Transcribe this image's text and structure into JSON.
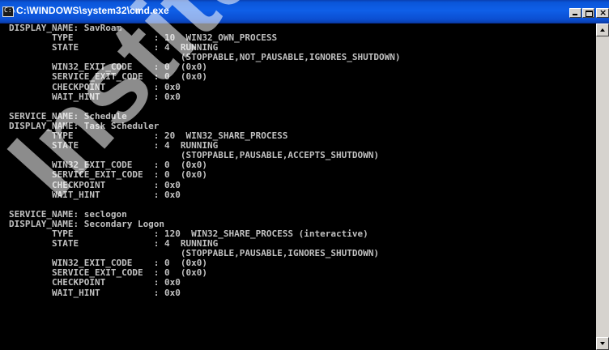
{
  "window": {
    "title": "C:\\WINDOWS\\system32\\cmd.exe",
    "icon_text": "C:\\",
    "controls": {
      "minimize": "minimize",
      "maximize": "maximize",
      "close": "×"
    }
  },
  "console": {
    "lines": [
      "DISPLAY_NAME: SavRoam",
      "        TYPE               : 10  WIN32_OWN_PROCESS",
      "        STATE              : 4  RUNNING",
      "                                (STOPPABLE,NOT_PAUSABLE,IGNORES_SHUTDOWN)",
      "        WIN32_EXIT_CODE    : 0  (0x0)",
      "        SERVICE_EXIT_CODE  : 0  (0x0)",
      "        CHECKPOINT         : 0x0",
      "        WAIT_HINT          : 0x0",
      "",
      "SERVICE_NAME: Schedule",
      "DISPLAY_NAME: Task Scheduler",
      "        TYPE               : 20  WIN32_SHARE_PROCESS",
      "        STATE              : 4  RUNNING",
      "                                (STOPPABLE,PAUSABLE,ACCEPTS_SHUTDOWN)",
      "        WIN32_EXIT_CODE    : 0  (0x0)",
      "        SERVICE_EXIT_CODE  : 0  (0x0)",
      "        CHECKPOINT         : 0x0",
      "        WAIT_HINT          : 0x0",
      "",
      "SERVICE_NAME: seclogon",
      "DISPLAY_NAME: Secondary Logon",
      "        TYPE               : 120  WIN32_SHARE_PROCESS (interactive)",
      "        STATE              : 4  RUNNING",
      "                                (STOPPABLE,PAUSABLE,IGNORES_SHUTDOWN)",
      "        WIN32_EXIT_CODE    : 0  (0x0)",
      "        SERVICE_EXIT_CODE  : 0  (0x0)",
      "        CHECKPOINT         : 0x0",
      "        WAIT_HINT          : 0x0",
      "",
      ""
    ]
  },
  "watermark": {
    "text": "Institute"
  },
  "colors": {
    "console_bg": "#000000",
    "console_text": "#c0c0c0",
    "titlebar": "#0a55d8"
  }
}
